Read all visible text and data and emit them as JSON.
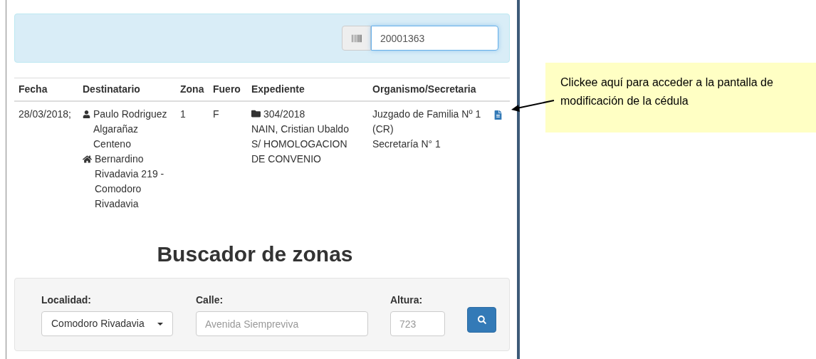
{
  "search_bar": {
    "value": "20001363"
  },
  "table": {
    "columns": [
      "Fecha",
      "Destinatario",
      "Zona",
      "Fuero",
      "Expediente",
      "Organismo/Secretaria"
    ],
    "rows": [
      {
        "fecha": "28/03/2018;",
        "destinatario": "Paulo Rodriguez Algarañaz Centeno",
        "domicilio": "Bernardino Rivadavia 219 - Comodoro Rivadavia",
        "zona": "1",
        "fuero": "F",
        "expediente": "304/2018",
        "caratula": "NAIN, Cristian Ubaldo S/ HOMOLOGACION DE CONVENIO",
        "organismo": "Juzgado de Familia Nº 1 (CR)",
        "secretaria": "Secretaría N° 1"
      }
    ]
  },
  "zone_finder": {
    "title": "Buscador de zonas",
    "localidad": {
      "label": "Localidad:",
      "value": "Comodoro Rivadavia"
    },
    "calle": {
      "label": "Calle:",
      "placeholder": "Avenida Siempreviva"
    },
    "altura": {
      "label": "Altura:",
      "placeholder": "723"
    }
  },
  "callout": {
    "text": "Clickee aquí para acceder a la pantalla de modificación de la cédula"
  }
}
